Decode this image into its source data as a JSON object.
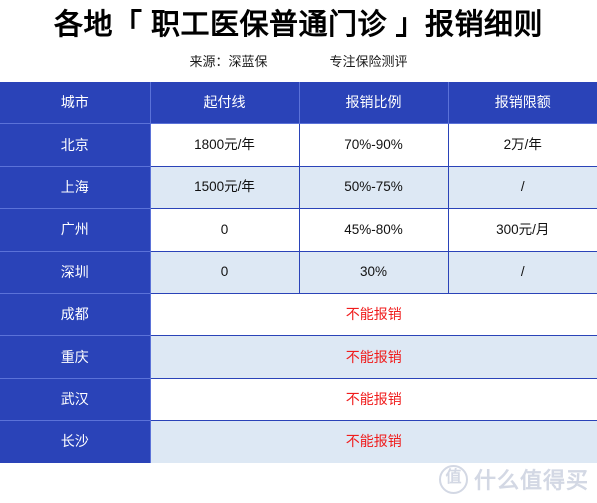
{
  "header": {
    "title": "各地「 职工医保普通门诊 」报销细则",
    "source_label": "来源：深蓝保",
    "tagline": "专注保险测评"
  },
  "table": {
    "columns": [
      "城市",
      "起付线",
      "报销比例",
      "报销限额"
    ],
    "rows": [
      {
        "city": "北京",
        "deductible": "1800元/年",
        "ratio": "70%-90%",
        "cap": "2万/年",
        "merged": false
      },
      {
        "city": "上海",
        "deductible": "1500元/年",
        "ratio": "50%-75%",
        "cap": "/",
        "merged": false
      },
      {
        "city": "广州",
        "deductible": "0",
        "ratio": "45%-80%",
        "cap": "300元/月",
        "merged": false
      },
      {
        "city": "深圳",
        "deductible": "0",
        "ratio": "30%",
        "cap": "/",
        "merged": false
      },
      {
        "city": "成都",
        "note": "不能报销",
        "merged": true
      },
      {
        "city": "重庆",
        "note": "不能报销",
        "merged": true
      },
      {
        "city": "武汉",
        "note": "不能报销",
        "merged": true
      },
      {
        "city": "长沙",
        "note": "不能报销",
        "merged": true
      }
    ]
  },
  "watermark": {
    "badge": "值",
    "text": "什么值得买"
  },
  "colors": {
    "header_blue": "#2a43b8",
    "row_alt": "#dde8f4",
    "row_base": "#ffffff",
    "no_reimburse_red": "#f01c1c",
    "watermark_gray": "#d3d8e4"
  }
}
